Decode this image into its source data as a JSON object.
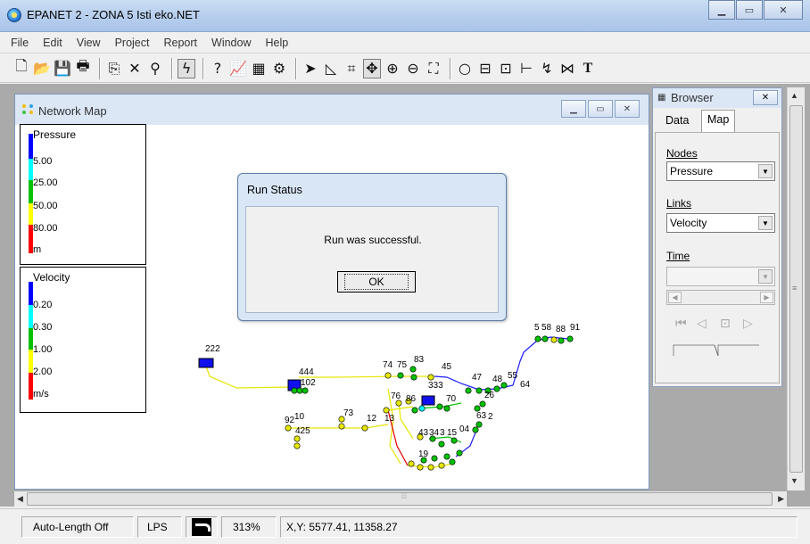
{
  "window": {
    "title": "EPANET 2 - ZONA 5 Isti eko.NET",
    "buttons": [
      "minimize",
      "maximize",
      "close"
    ]
  },
  "menu": [
    "File",
    "Edit",
    "View",
    "Project",
    "Report",
    "Window",
    "Help"
  ],
  "toolbar": {
    "buttons": [
      {
        "name": "new-icon",
        "glyph": "🗋"
      },
      {
        "name": "open-icon",
        "glyph": "📂"
      },
      {
        "name": "save-icon",
        "glyph": "💾"
      },
      {
        "name": "print-icon",
        "glyph": "🖶"
      },
      {
        "name": "copy-icon",
        "glyph": "⎘"
      },
      {
        "name": "delete-icon",
        "glyph": "✕"
      },
      {
        "name": "find-icon",
        "glyph": "⚲"
      },
      {
        "name": "run-icon",
        "glyph": "ϟ"
      },
      {
        "name": "query-icon",
        "glyph": "?"
      },
      {
        "name": "graph-icon",
        "glyph": "📈"
      },
      {
        "name": "table-icon",
        "glyph": "▦"
      },
      {
        "name": "options-icon",
        "glyph": "⚙"
      },
      {
        "name": "select-object-icon",
        "glyph": "➤"
      },
      {
        "name": "select-vertex-icon",
        "glyph": "◺"
      },
      {
        "name": "select-region-icon",
        "glyph": "⌗"
      },
      {
        "name": "pan-icon",
        "glyph": "✥"
      },
      {
        "name": "zoom-in-icon",
        "glyph": "⊕"
      },
      {
        "name": "zoom-out-icon",
        "glyph": "⊖"
      },
      {
        "name": "full-extent-icon",
        "glyph": "⛶"
      },
      {
        "name": "add-junction-icon",
        "glyph": "○"
      },
      {
        "name": "add-reservoir-icon",
        "glyph": "⊟"
      },
      {
        "name": "add-tank-icon",
        "glyph": "⊡"
      },
      {
        "name": "add-pipe-icon",
        "glyph": "⊢"
      },
      {
        "name": "add-pump-icon",
        "glyph": "↯"
      },
      {
        "name": "add-valve-icon",
        "glyph": "⋈"
      },
      {
        "name": "add-label-icon",
        "glyph": "T"
      }
    ]
  },
  "map_window": {
    "title": "Network Map",
    "pressure_legend": {
      "title": "Pressure",
      "labels": [
        "5.00",
        "25.00",
        "50.00",
        "80.00",
        "m"
      ],
      "colors": [
        "#0000ff",
        "#00ffff",
        "#00c000",
        "#ffff00",
        "#ff0000"
      ]
    },
    "velocity_legend": {
      "title": "Velocity",
      "labels": [
        "0.20",
        "0.30",
        "1.00",
        "2.00",
        "m/s"
      ],
      "colors": [
        "#0000ff",
        "#00ffff",
        "#00c000",
        "#ffff00",
        "#ff0000"
      ]
    },
    "node_labels": [
      "222",
      "444",
      "102",
      "74",
      "75",
      "83",
      "45",
      "333",
      "47",
      "48",
      "55",
      "64",
      "26",
      "76",
      "86",
      "70",
      "63",
      "2",
      "92",
      "10",
      "425",
      "73",
      "12",
      "13",
      "43",
      "34",
      "3",
      "15",
      "04",
      "19",
      "5",
      "58",
      "88",
      "91"
    ]
  },
  "dialog": {
    "title": "Run Status",
    "message": "Run was successful.",
    "ok_label": "OK"
  },
  "browser": {
    "title": "Browser",
    "tabs": [
      "Data",
      "Map"
    ],
    "active_tab": "Map",
    "nodes_label": "Nodes",
    "nodes_value": "Pressure",
    "links_label": "Links",
    "links_value": "Velocity",
    "time_label": "Time",
    "time_value": ""
  },
  "status": {
    "auto_length": "Auto-Length Off",
    "flow_units": "LPS",
    "zoom": "313%",
    "coords": "X,Y: 5577.41, 11358.27"
  }
}
